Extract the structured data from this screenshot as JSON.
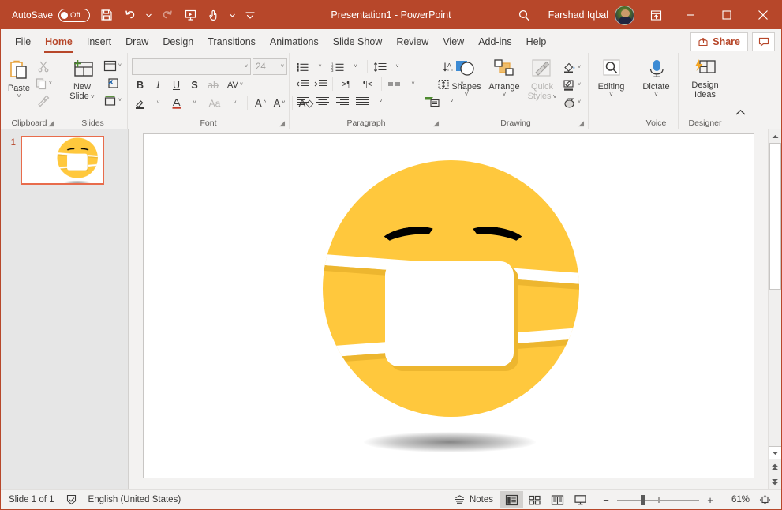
{
  "titlebar": {
    "autosave_label": "AutoSave",
    "autosave_state": "Off",
    "title": "Presentation1  -  PowerPoint",
    "user_name": "Farshad Iqbal",
    "quick_access": [
      {
        "name": "save-icon",
        "label": "Save"
      },
      {
        "name": "undo-icon",
        "label": "Undo"
      },
      {
        "name": "redo-icon",
        "label": "Redo"
      },
      {
        "name": "start-presentation-icon",
        "label": "Start From Beginning"
      },
      {
        "name": "touch-mode-icon",
        "label": "Touch/Mouse Mode"
      },
      {
        "name": "customize-qat-icon",
        "label": "Customize Quick Access Toolbar"
      }
    ],
    "search_icon": "search-icon",
    "ribbon_display_icon": "ribbon-display-options-icon",
    "minimize_icon": "minimize-icon",
    "maximize_icon": "maximize-icon",
    "close_icon": "close-icon"
  },
  "tabs": [
    {
      "label": "File",
      "active": false
    },
    {
      "label": "Home",
      "active": true
    },
    {
      "label": "Insert",
      "active": false
    },
    {
      "label": "Draw",
      "active": false
    },
    {
      "label": "Design",
      "active": false
    },
    {
      "label": "Transitions",
      "active": false
    },
    {
      "label": "Animations",
      "active": false
    },
    {
      "label": "Slide Show",
      "active": false
    },
    {
      "label": "Review",
      "active": false
    },
    {
      "label": "View",
      "active": false
    },
    {
      "label": "Add-ins",
      "active": false
    },
    {
      "label": "Help",
      "active": false
    }
  ],
  "tabbar_right": {
    "share_label": "Share",
    "share_icon": "share-icon",
    "comments_icon": "comment-icon"
  },
  "ribbon": {
    "clipboard": {
      "group_label": "Clipboard",
      "paste_label": "Paste",
      "cut_label": "Cut",
      "copy_label": "Copy",
      "format_painter_label": "Format Painter",
      "dialog_launcher": "dialog-launcher-icon"
    },
    "slides": {
      "group_label": "Slides",
      "new_slide_label": "New\nSlide",
      "new_slide_line1": "New",
      "new_slide_line2": "Slide",
      "layout_label": "Layout",
      "reset_label": "Reset",
      "section_label": "Section"
    },
    "font": {
      "group_label": "Font",
      "font_name_value": "",
      "font_size_value": "24",
      "bold": "B",
      "italic": "I",
      "underline": "U",
      "shadow": "S",
      "strikethrough": "ab",
      "char_spacing": "AV",
      "change_case": "Aa",
      "increase_font": "A",
      "decrease_font": "A",
      "clear_formatting": "A",
      "text_highlight": "text-highlight-icon",
      "font_color": "font-color-icon",
      "dialog_launcher": "dialog-launcher-icon"
    },
    "paragraph": {
      "group_label": "Paragraph",
      "bullets": "bullets-icon",
      "numbering": "numbering-icon",
      "line_spacing": "line-spacing-icon",
      "text_direction": "text-direction-icon",
      "decrease_indent": "decrease-indent-icon",
      "increase_indent": "increase-indent-icon",
      "ltr": "left-to-right-icon",
      "rtl": "right-to-left-icon",
      "columns": "columns-icon",
      "align_text": "align-text-icon",
      "align_left": "align-left-icon",
      "align_center": "align-center-icon",
      "align_right": "align-right-icon",
      "justify": "justify-icon",
      "smartart": "convert-to-smartart-icon",
      "dialog_launcher": "dialog-launcher-icon"
    },
    "drawing": {
      "group_label": "Drawing",
      "shapes_label": "Shapes",
      "arrange_label": "Arrange",
      "quick_styles_line1": "Quick",
      "quick_styles_line2": "Styles",
      "shape_fill": "shape-fill-icon",
      "shape_outline": "shape-outline-icon",
      "shape_effects": "shape-effects-icon",
      "dialog_launcher": "dialog-launcher-icon"
    },
    "editing": {
      "group_label": "",
      "editing_label": "Editing",
      "editing_icon": "find-icon"
    },
    "voice": {
      "group_label": "Voice",
      "dictate_label": "Dictate",
      "dictate_icon": "microphone-icon"
    },
    "designer": {
      "group_label": "Designer",
      "design_ideas_line1": "Design",
      "design_ideas_line2": "Ideas",
      "design_ideas_icon": "design-ideas-icon"
    },
    "collapse_icon": "collapse-ribbon-icon"
  },
  "thumbnails": [
    {
      "number": "1",
      "selected": true
    }
  ],
  "slide": {
    "content_name": "face-with-medical-mask-emoji",
    "background": "#FFFFFF",
    "emoji_colors": {
      "face": "#FFC83D",
      "face_shadow": "#EDB62F",
      "mask": "#FFFFFF",
      "eyes": "#000000"
    }
  },
  "scrollbar": {
    "up_icon": "scroll-up-icon",
    "down_icon": "scroll-down-icon",
    "previous_slide_icon": "previous-slide-icon",
    "next_slide_icon": "next-slide-icon"
  },
  "statusbar": {
    "slide_count": "Slide 1 of 1",
    "spellcheck_icon": "spellcheck-icon",
    "language": "English (United States)",
    "notes_label": "Notes",
    "notes_icon": "notes-icon",
    "views": [
      {
        "name": "normal-view",
        "icon": "normal-view-icon",
        "active": true
      },
      {
        "name": "slide-sorter-view",
        "icon": "slide-sorter-icon",
        "active": false
      },
      {
        "name": "reading-view",
        "icon": "reading-view-icon",
        "active": false
      },
      {
        "name": "slide-show-view",
        "icon": "slide-show-icon",
        "active": false
      }
    ],
    "zoom_out": "−",
    "zoom_in": "+",
    "zoom_level": "61%",
    "fit_icon": "fit-to-window-icon"
  },
  "theme": {
    "accent": "#b7472a",
    "ribbon_bg": "#f3f2f1",
    "thumb_pane_bg": "#e6e6e6"
  }
}
